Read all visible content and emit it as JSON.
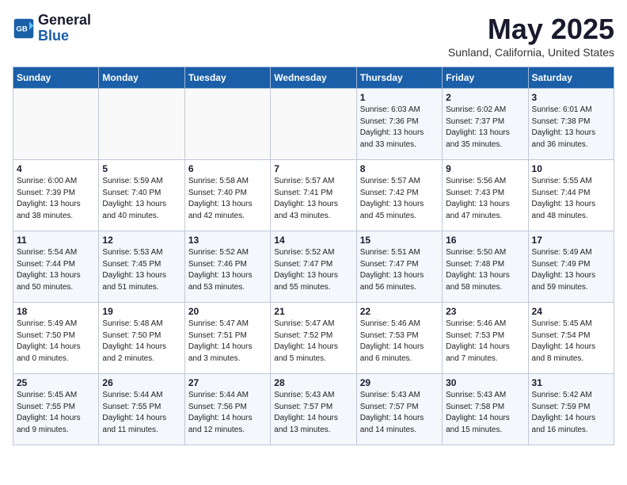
{
  "header": {
    "logo_general": "General",
    "logo_blue": "Blue",
    "title": "May 2025",
    "subtitle": "Sunland, California, United States"
  },
  "weekdays": [
    "Sunday",
    "Monday",
    "Tuesday",
    "Wednesday",
    "Thursday",
    "Friday",
    "Saturday"
  ],
  "weeks": [
    [
      {
        "day": "",
        "info": ""
      },
      {
        "day": "",
        "info": ""
      },
      {
        "day": "",
        "info": ""
      },
      {
        "day": "",
        "info": ""
      },
      {
        "day": "1",
        "info": "Sunrise: 6:03 AM\nSunset: 7:36 PM\nDaylight: 13 hours\nand 33 minutes."
      },
      {
        "day": "2",
        "info": "Sunrise: 6:02 AM\nSunset: 7:37 PM\nDaylight: 13 hours\nand 35 minutes."
      },
      {
        "day": "3",
        "info": "Sunrise: 6:01 AM\nSunset: 7:38 PM\nDaylight: 13 hours\nand 36 minutes."
      }
    ],
    [
      {
        "day": "4",
        "info": "Sunrise: 6:00 AM\nSunset: 7:39 PM\nDaylight: 13 hours\nand 38 minutes."
      },
      {
        "day": "5",
        "info": "Sunrise: 5:59 AM\nSunset: 7:40 PM\nDaylight: 13 hours\nand 40 minutes."
      },
      {
        "day": "6",
        "info": "Sunrise: 5:58 AM\nSunset: 7:40 PM\nDaylight: 13 hours\nand 42 minutes."
      },
      {
        "day": "7",
        "info": "Sunrise: 5:57 AM\nSunset: 7:41 PM\nDaylight: 13 hours\nand 43 minutes."
      },
      {
        "day": "8",
        "info": "Sunrise: 5:57 AM\nSunset: 7:42 PM\nDaylight: 13 hours\nand 45 minutes."
      },
      {
        "day": "9",
        "info": "Sunrise: 5:56 AM\nSunset: 7:43 PM\nDaylight: 13 hours\nand 47 minutes."
      },
      {
        "day": "10",
        "info": "Sunrise: 5:55 AM\nSunset: 7:44 PM\nDaylight: 13 hours\nand 48 minutes."
      }
    ],
    [
      {
        "day": "11",
        "info": "Sunrise: 5:54 AM\nSunset: 7:44 PM\nDaylight: 13 hours\nand 50 minutes."
      },
      {
        "day": "12",
        "info": "Sunrise: 5:53 AM\nSunset: 7:45 PM\nDaylight: 13 hours\nand 51 minutes."
      },
      {
        "day": "13",
        "info": "Sunrise: 5:52 AM\nSunset: 7:46 PM\nDaylight: 13 hours\nand 53 minutes."
      },
      {
        "day": "14",
        "info": "Sunrise: 5:52 AM\nSunset: 7:47 PM\nDaylight: 13 hours\nand 55 minutes."
      },
      {
        "day": "15",
        "info": "Sunrise: 5:51 AM\nSunset: 7:47 PM\nDaylight: 13 hours\nand 56 minutes."
      },
      {
        "day": "16",
        "info": "Sunrise: 5:50 AM\nSunset: 7:48 PM\nDaylight: 13 hours\nand 58 minutes."
      },
      {
        "day": "17",
        "info": "Sunrise: 5:49 AM\nSunset: 7:49 PM\nDaylight: 13 hours\nand 59 minutes."
      }
    ],
    [
      {
        "day": "18",
        "info": "Sunrise: 5:49 AM\nSunset: 7:50 PM\nDaylight: 14 hours\nand 0 minutes."
      },
      {
        "day": "19",
        "info": "Sunrise: 5:48 AM\nSunset: 7:50 PM\nDaylight: 14 hours\nand 2 minutes."
      },
      {
        "day": "20",
        "info": "Sunrise: 5:47 AM\nSunset: 7:51 PM\nDaylight: 14 hours\nand 3 minutes."
      },
      {
        "day": "21",
        "info": "Sunrise: 5:47 AM\nSunset: 7:52 PM\nDaylight: 14 hours\nand 5 minutes."
      },
      {
        "day": "22",
        "info": "Sunrise: 5:46 AM\nSunset: 7:53 PM\nDaylight: 14 hours\nand 6 minutes."
      },
      {
        "day": "23",
        "info": "Sunrise: 5:46 AM\nSunset: 7:53 PM\nDaylight: 14 hours\nand 7 minutes."
      },
      {
        "day": "24",
        "info": "Sunrise: 5:45 AM\nSunset: 7:54 PM\nDaylight: 14 hours\nand 8 minutes."
      }
    ],
    [
      {
        "day": "25",
        "info": "Sunrise: 5:45 AM\nSunset: 7:55 PM\nDaylight: 14 hours\nand 9 minutes."
      },
      {
        "day": "26",
        "info": "Sunrise: 5:44 AM\nSunset: 7:55 PM\nDaylight: 14 hours\nand 11 minutes."
      },
      {
        "day": "27",
        "info": "Sunrise: 5:44 AM\nSunset: 7:56 PM\nDaylight: 14 hours\nand 12 minutes."
      },
      {
        "day": "28",
        "info": "Sunrise: 5:43 AM\nSunset: 7:57 PM\nDaylight: 14 hours\nand 13 minutes."
      },
      {
        "day": "29",
        "info": "Sunrise: 5:43 AM\nSunset: 7:57 PM\nDaylight: 14 hours\nand 14 minutes."
      },
      {
        "day": "30",
        "info": "Sunrise: 5:43 AM\nSunset: 7:58 PM\nDaylight: 14 hours\nand 15 minutes."
      },
      {
        "day": "31",
        "info": "Sunrise: 5:42 AM\nSunset: 7:59 PM\nDaylight: 14 hours\nand 16 minutes."
      }
    ]
  ]
}
